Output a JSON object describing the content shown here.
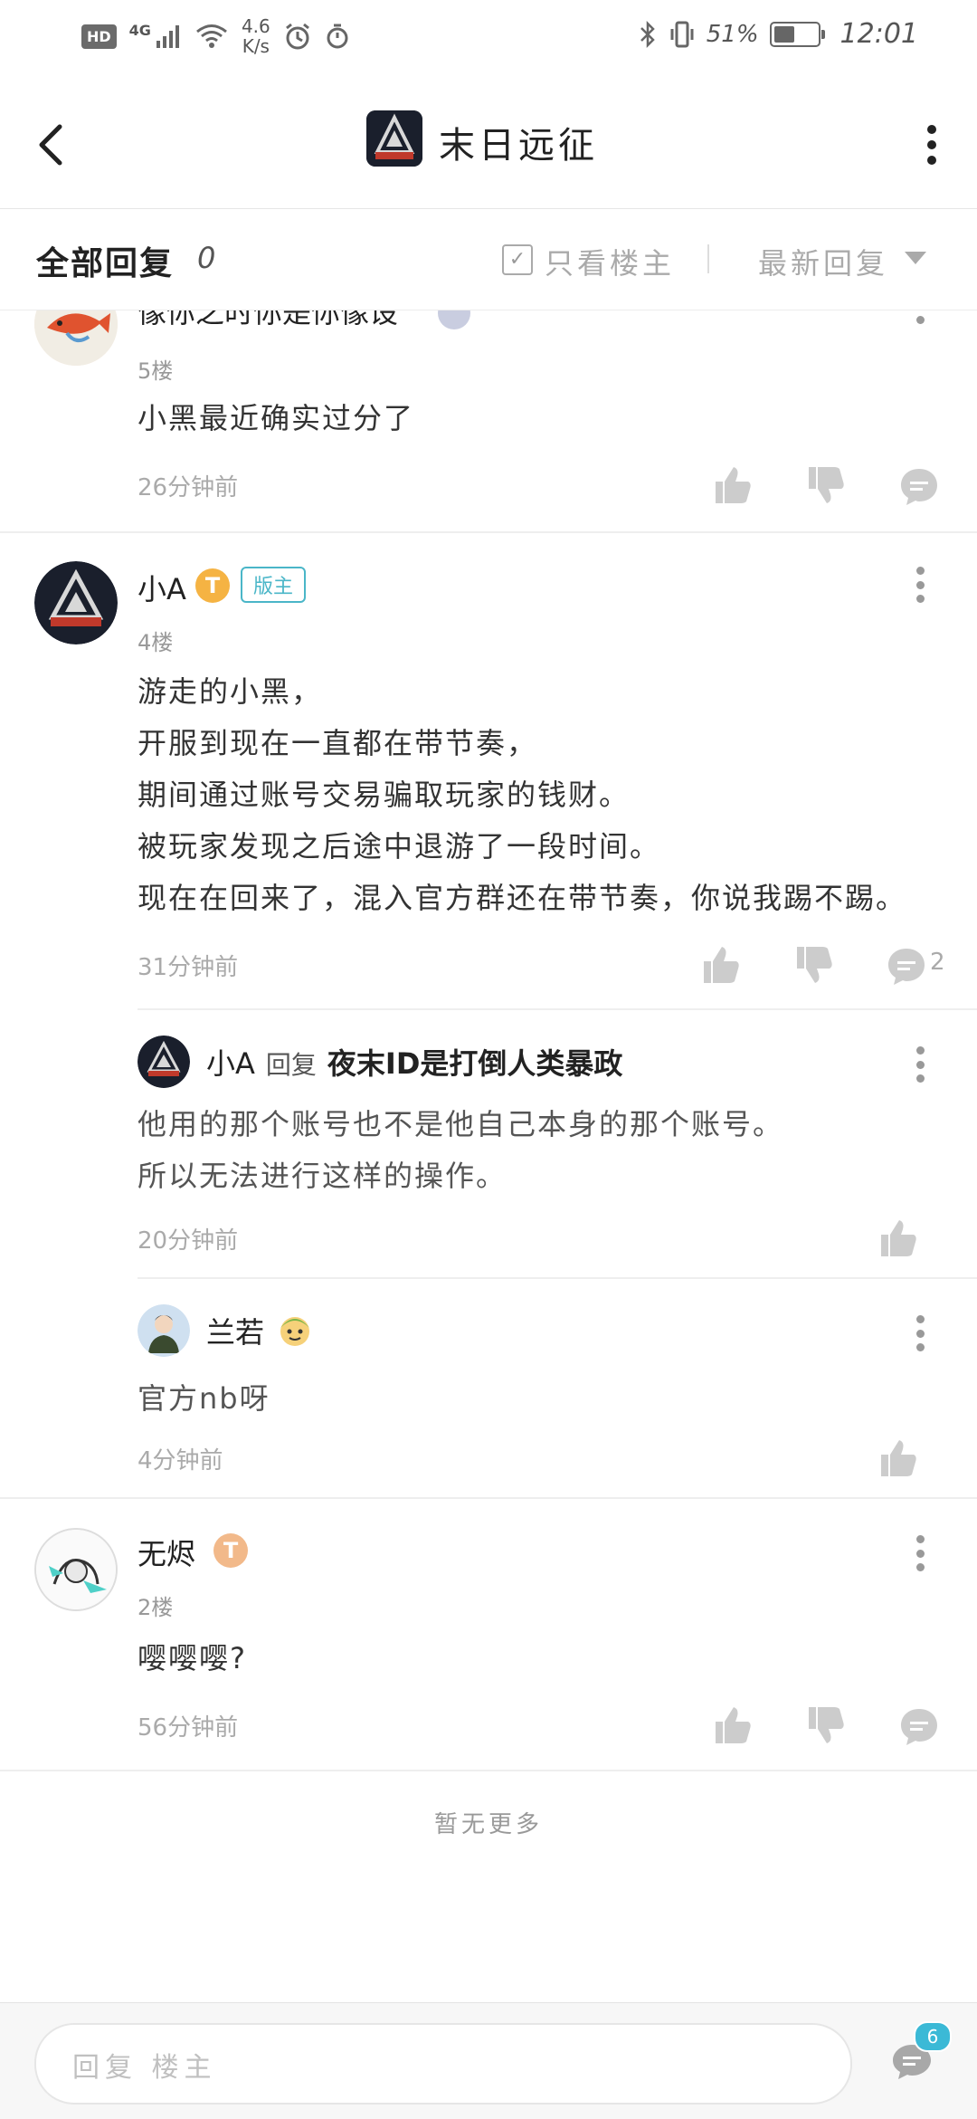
{
  "status_bar": {
    "hd": "HD",
    "signal": "4G",
    "speed_value": "4.6",
    "speed_unit": "K/s",
    "battery_pct": "51%",
    "battery_level": 0.51,
    "time": "12:01"
  },
  "header": {
    "title": "末日远征"
  },
  "filter": {
    "all_label": "全部回复",
    "count": "0",
    "only_op_label": "只看楼主",
    "sort_label": "最新回复"
  },
  "posts": [
    {
      "name": "像你之时你是你像设",
      "floor": "5楼",
      "content": "小黑最近确实过分了",
      "time": "26分钟前"
    },
    {
      "name": "小A",
      "badge": "T",
      "role": "版主",
      "floor": "4楼",
      "content": [
        "游走的小黑，",
        "开服到现在一直都在带节奏，",
        "期间通过账号交易骗取玩家的钱财。",
        "被玩家发现之后途中退游了一段时间。",
        "现在在回来了，混入官方群还在带节奏，你说我踢不踢。"
      ],
      "time": "31分钟前",
      "comment_count": "2",
      "replies": [
        {
          "name": "小A",
          "verb": "回复",
          "target": "夜末ID是打倒人类暴政",
          "content": [
            "他用的那个账号也不是他自己本身的那个账号。",
            "所以无法进行这样的操作。"
          ],
          "time": "20分钟前"
        },
        {
          "name": "兰若",
          "content": "官方nb呀",
          "time": "4分钟前"
        }
      ]
    },
    {
      "name": "无烬",
      "badge": "T",
      "floor": "2楼",
      "content": "嘤嘤嘤?",
      "time": "56分钟前"
    }
  ],
  "footer": {
    "no_more": "暂无更多"
  },
  "reply_bar": {
    "placeholder": "回复 楼主",
    "msg_count": "6"
  },
  "colors": {
    "accent": "#3bb9d6",
    "gold_badge": "#f5b343",
    "mod_tag": "#4ab6c8"
  }
}
